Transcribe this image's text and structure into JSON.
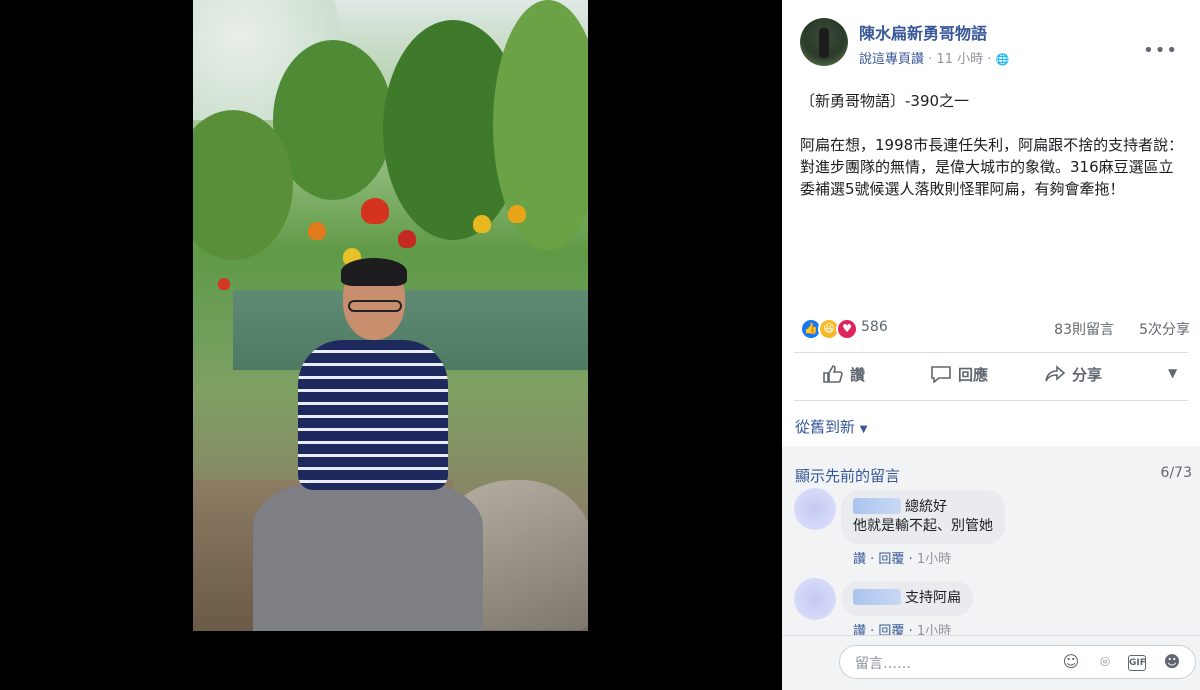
{
  "page": {
    "name": "陳水扁新勇哥物語",
    "meta_link": "說這專頁讚",
    "meta_time": "11 小時",
    "meta_sep": "·",
    "globe": "🌐"
  },
  "post": {
    "line1": "〔新勇哥物語〕-390之一",
    "body": "阿扁在想，1998市長連任失利，阿扁跟不捨的支持者說：對進步團隊的無情，是偉大城市的象徵。316麻豆選區立委補選5號候選人落敗則怪罪阿扁，有夠會牽拖！"
  },
  "reactions": {
    "count": "586",
    "comments": "83則留言",
    "shares": "5次分享",
    "icons": [
      "like-icon",
      "haha-icon",
      "love-icon"
    ],
    "colors": {
      "like": "#1877f2",
      "haha": "#f7b928",
      "love": "#e0245e"
    }
  },
  "actions": {
    "like": "讚",
    "comment": "回應",
    "share": "分享"
  },
  "sort": "從舊到新",
  "comments": {
    "prev_label": "顯示先前的留言",
    "count": "6/73",
    "items": [
      {
        "line1": "總統好",
        "line2": "他就是輸不起、別管她",
        "like": "讚",
        "reply": "回覆",
        "time": "1小時"
      },
      {
        "line1": "支持阿扁",
        "like": "讚",
        "reply": "回覆",
        "time": "1小時"
      }
    ]
  },
  "composer": {
    "placeholder": "留言……"
  }
}
